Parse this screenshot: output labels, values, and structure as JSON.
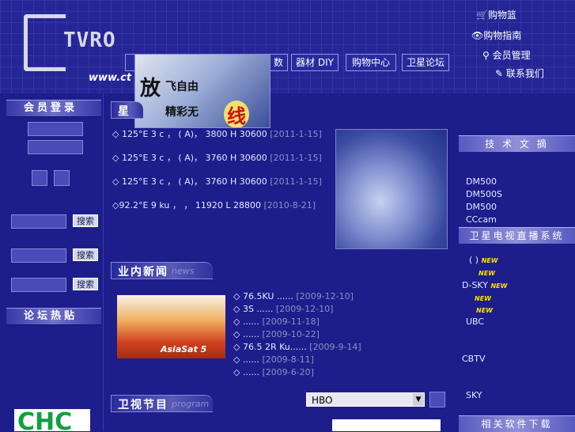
{
  "site": {
    "logo_text": "TVRO",
    "logo_url": "www.ct"
  },
  "top_links": [
    {
      "icon": "cart-icon",
      "label": "购物篮"
    },
    {
      "icon": "eye-icon",
      "label": "购物指南"
    },
    {
      "icon": "key-icon",
      "label": "会员管理"
    },
    {
      "icon": "pen-icon",
      "label": "联系我们"
    }
  ],
  "nav": [
    {
      "label": "数"
    },
    {
      "label": "器材 DIY"
    },
    {
      "label": "购物中心"
    },
    {
      "label": "卫星论坛"
    }
  ],
  "banner": {
    "big_char": "放",
    "line1": "飞自由",
    "line2": "精彩无",
    "highlight": "线"
  },
  "left": {
    "member_login": "会员登录",
    "search_label": "搜索",
    "forum_hot": "论坛热贴",
    "logo_text": "CHC"
  },
  "satellite_section": {
    "title": "星",
    "items": [
      {
        "text": "◇ 125°E 3 c ， ( A)， 3800 H 30600",
        "date": "[2011-1-15]"
      },
      {
        "text": "◇ 125°E 3 c ， ( A)， 3760 H 30600",
        "date": "[2011-1-15]"
      },
      {
        "text": "◇ 125°E 3 c ， ( A)， 3760 H 30600",
        "date": "[2011-1-15]"
      },
      {
        "text": "◇92.2°E 9 ku ， ， 11920 L 28800",
        "date": "[2010-8-21]"
      }
    ]
  },
  "news_section": {
    "title": "业内新闻",
    "title_en": "news",
    "image_caption": "AsiaSat 5",
    "items": [
      {
        "text": "◇ 76.5KU ......",
        "date": "[2009-12-10]"
      },
      {
        "text": "◇ 3S ......",
        "date": "[2009-12-10]"
      },
      {
        "text": "◇ ......",
        "date": "[2009-11-18]"
      },
      {
        "text": "◇ ......",
        "date": "[2009-10-22]"
      },
      {
        "text": "◇ 76.5 2R Ku......",
        "date": "[2009-9-14]"
      },
      {
        "text": "◇ ......",
        "date": "[2009-8-11]"
      },
      {
        "text": "◇ ......",
        "date": "[2009-6-20]"
      }
    ]
  },
  "program_section": {
    "title": "卫视节目",
    "title_en": "program",
    "select_value": "HBO"
  },
  "right": {
    "tech_title": "技 术 文 摘",
    "tech_items": [
      "DM500",
      "DM500S",
      "DM500",
      "CCcam"
    ],
    "live_title": "卫星电视直播系统",
    "live_items": [
      {
        "label": "( )",
        "new": "NEW"
      },
      {
        "label": "",
        "new": "NEW"
      },
      {
        "label": "D-SKY",
        "new": "NEW"
      },
      {
        "label": "",
        "new": "NEW"
      },
      {
        "label": "",
        "new": "NEW"
      },
      {
        "label": "UBC",
        "new": ""
      },
      {
        "label": "CBTV",
        "new": ""
      },
      {
        "label": "SKY",
        "new": ""
      }
    ],
    "software_title": "相关软件下载"
  },
  "colors": {
    "background": "#1d1d8c",
    "badge_new": "#ffe000",
    "date_text": "#9090c0"
  }
}
